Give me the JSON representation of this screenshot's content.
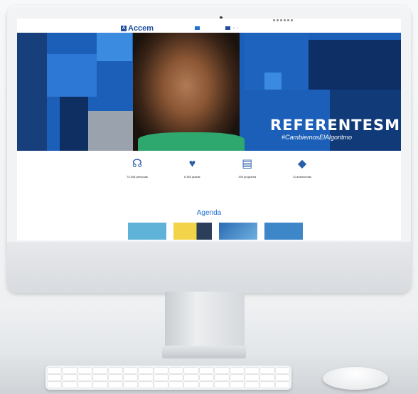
{
  "header": {
    "logo_text": "Accem",
    "nav_items": [
      "",
      "",
      "",
      "",
      "",
      "",
      ""
    ]
  },
  "hero": {
    "title": "REFERENTESM",
    "hashtag": "#CambiemosElAlgoritmo"
  },
  "stats": [
    {
      "icon": "people-icon",
      "number": "74.345 personas",
      "sublabel": ""
    },
    {
      "icon": "hands-heart-icon",
      "number": "6.352 plazas",
      "sublabel": ""
    },
    {
      "icon": "document-icon",
      "number": "195 programa",
      "sublabel": ""
    },
    {
      "icon": "map-spain-icon",
      "number": "11 autonomías",
      "sublabel": ""
    }
  ],
  "agenda": {
    "title": "Agenda"
  },
  "colors": {
    "brand": "#1f4e9c",
    "accent": "#1f6fd1",
    "hero": "#1b5fb8"
  }
}
